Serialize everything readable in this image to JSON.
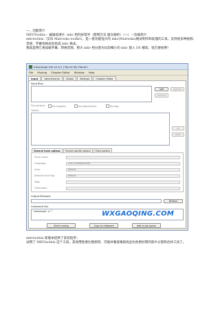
{
  "article": {
    "intro": "一、功能简介\nMKVToolnix – 编辑高清片 .mkv 档的好帮手（使用方法 图文解析）（一）—功能简介\nmkvtoolnix（又叫 Matroska toolkit），是一套功能强大的 mkv(Matroska)格式制作和处理的工具，支持很多种视频、音频、字幕等格式封装成 mkv 格式。\n我就是用它来加载字幕、转换音频、把大 mkv 档分割为比较细小的 mkv 放入 DS 播等、很方便易用！",
    "outro": "mkvtoolnix 新版本提供了安装程序：\n试用了 MKVtoolnix 这个工具，其易用性要比我想得、可能并着很难再找出比他更好用的影片分割和合并工具了。"
  },
  "window": {
    "title": "mkvmerge GUI v2.0.2 ('You're My Flame')",
    "menu": [
      "File",
      "Muxing",
      "Chapter Editor",
      "Window",
      "Help"
    ],
    "tabs": [
      "Input",
      "Attachments",
      "Global",
      "Settings",
      "Chapter Editor"
    ],
    "input_files_label": "Input files:",
    "buttons": {
      "add": "add",
      "append": "append",
      "remove": "remove",
      "up": "up",
      "down": "down",
      "browse": "Browse",
      "start": "Start muxing",
      "copy": "Copy to clipboard",
      "add_job": "Add to job queue"
    },
    "file_options_label": "File options:",
    "checkboxes": [
      "No chapters",
      "No attachments",
      "No tags"
    ],
    "tracks_label": "Tracks:",
    "subtabs": [
      "General track options",
      "Format specific options",
      "Extra options"
    ],
    "fields": [
      {
        "label": "Track name:",
        "value": ""
      },
      {
        "label": "Language:",
        "value": "und (Undetermined)"
      },
      {
        "label": "Cues:",
        "value": "default"
      },
      {
        "label": "Default track flag:",
        "value": "default"
      },
      {
        "label": "Tags:",
        "value": ""
      },
      {
        "label": "Timecodes:",
        "value": ""
      }
    ],
    "output_label": "Output filename",
    "command_label": "Command line",
    "command_text": "\"mkvmerge\" -o \"\""
  },
  "watermark": "WXGAOQING.COM"
}
